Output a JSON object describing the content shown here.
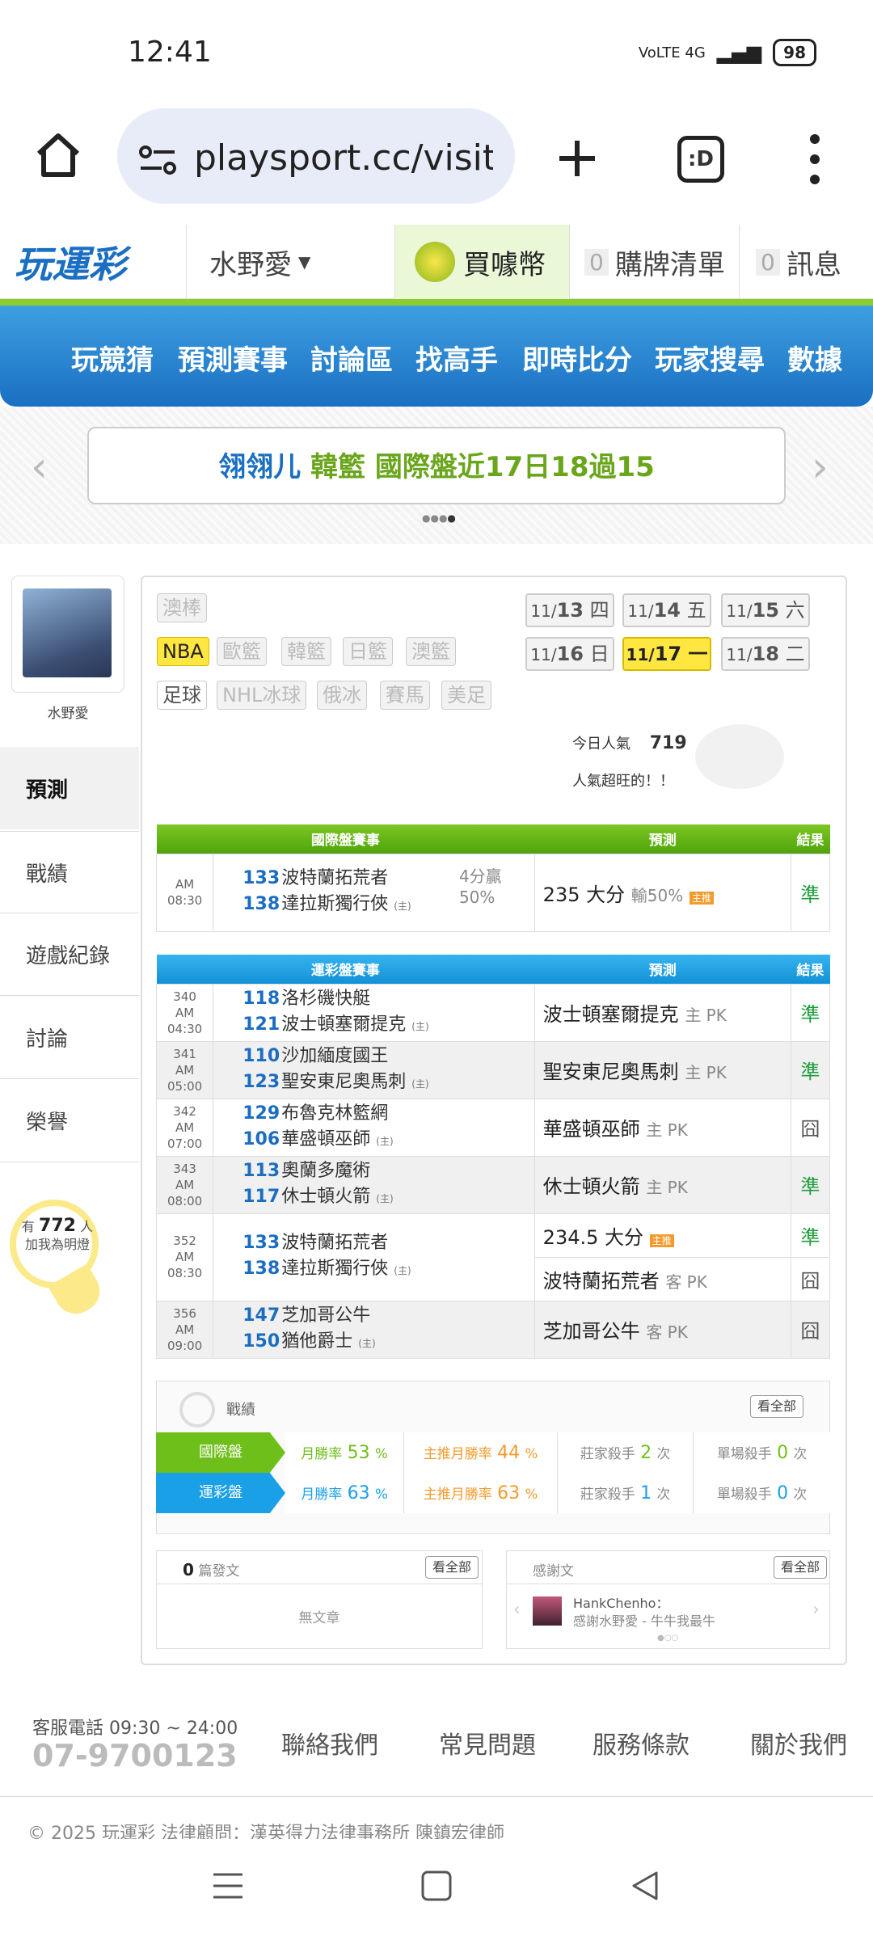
{
  "status_bar": {
    "time": "12:41",
    "network": "VoLTE 4G",
    "battery": "98"
  },
  "browser": {
    "url": "playsport.cc/visit",
    "tab_icon": ":D"
  },
  "site_header": {
    "logo": "玩運彩",
    "username": "水野愛",
    "buy_coins": "買噱幣",
    "buy_count": "0",
    "buy_list": "購牌清單",
    "msg_count": "0",
    "messages": "訊息"
  },
  "nav": {
    "items": [
      "玩競猜",
      "預測賽事",
      "討論區",
      "找高手",
      "即時比分",
      "玩家搜尋",
      "數據"
    ]
  },
  "banner": {
    "name": "翎翎儿",
    "text": "韓籃 國際盤近17日18過15"
  },
  "profile": {
    "name": "水野愛"
  },
  "side_tabs": [
    "預測",
    "戰績",
    "遊戲紀錄",
    "討論",
    "榮譽"
  ],
  "lamp": {
    "prefix": "有",
    "count": "772",
    "suffix": "人",
    "line2": "加我為明燈"
  },
  "sports": {
    "row1": [
      "澳棒"
    ],
    "row2": [
      "NBA",
      "歐籃",
      "韓籃",
      "日籃",
      "澳籃"
    ],
    "row3": [
      "足球",
      "NHL冰球",
      "俄冰",
      "賽馬",
      "美足"
    ]
  },
  "dates": [
    {
      "md": "11/",
      "d": "13",
      "w": "四"
    },
    {
      "md": "11/",
      "d": "14",
      "w": "五"
    },
    {
      "md": "11/",
      "d": "15",
      "w": "六"
    },
    {
      "md": "11/",
      "d": "16",
      "w": "日"
    },
    {
      "md": "11/",
      "d": "17",
      "w": "一"
    },
    {
      "md": "11/",
      "d": "18",
      "w": "二"
    }
  ],
  "popularity": {
    "label": "今日人氣",
    "value": "719",
    "note": "人氣超旺的！！"
  },
  "intl_table": {
    "headers": [
      "國際盤賽事",
      "預測",
      "結果"
    ],
    "rows": [
      {
        "time": "AM 08:30",
        "t1_no": "133",
        "t1": "波特蘭拓荒者",
        "t2_no": "138",
        "t2": "達拉斯獨行俠",
        "host": "(主)",
        "spread": "4分贏",
        "pct": "50%",
        "pred": "235 大分",
        "pred_note": "輸50%",
        "badge": "主推",
        "result": "準"
      }
    ]
  },
  "lottery_table": {
    "headers": [
      "運彩盤賽事",
      "預測",
      "結果"
    ],
    "rows": [
      {
        "num": "340",
        "time": "AM 04:30",
        "t1_no": "118",
        "t1": "洛杉磯快艇",
        "t2_no": "121",
        "t2": "波士頓塞爾提克",
        "pred": "波士頓塞爾提克",
        "pred_note": "主 PK",
        "result": "準"
      },
      {
        "num": "341",
        "time": "AM 05:00",
        "t1_no": "110",
        "t1": "沙加緬度國王",
        "t2_no": "123",
        "t2": "聖安東尼奧馬刺",
        "pred": "聖安東尼奧馬刺",
        "pred_note": "主 PK",
        "result": "準"
      },
      {
        "num": "342",
        "time": "AM 07:00",
        "t1_no": "129",
        "t1": "布魯克林籃網",
        "t2_no": "106",
        "t2": "華盛頓巫師",
        "pred": "華盛頓巫師",
        "pred_note": "主 PK",
        "result": "囧"
      },
      {
        "num": "343",
        "time": "AM 08:00",
        "t1_no": "113",
        "t1": "奧蘭多魔術",
        "t2_no": "117",
        "t2": "休士頓火箭",
        "pred": "休士頓火箭",
        "pred_note": "主 PK",
        "result": "準"
      },
      {
        "num": "352",
        "time": "AM 08:30",
        "t1_no": "133",
        "t1": "波特蘭拓荒者",
        "t2_no": "138",
        "t2": "達拉斯獨行俠",
        "pred": "234.5 大分",
        "pred_note": "",
        "badge": "主推",
        "result": "準",
        "pred2": "波特蘭拓荒者",
        "pred2_note": "客 PK",
        "result2": "囧"
      },
      {
        "num": "356",
        "time": "AM 09:00",
        "t1_no": "147",
        "t1": "芝加哥公牛",
        "t2_no": "150",
        "t2": "猶他爵士",
        "pred": "芝加哥公牛",
        "pred_note": "客 PK",
        "result": "囧"
      }
    ],
    "host": "(主)"
  },
  "record": {
    "title": "戰績",
    "view_all": "看全部",
    "rows": [
      {
        "label": "國際盤",
        "m_label": "月勝率",
        "m_val": "53",
        "p_label": "主推月勝率",
        "p_val": "44",
        "unit": "%",
        "z_label": "莊家殺手",
        "z_val": "2",
        "s_label": "單場殺手",
        "s_val": "0",
        "cnt": "次"
      },
      {
        "label": "運彩盤",
        "m_label": "月勝率",
        "m_val": "63",
        "p_label": "主推月勝率",
        "p_val": "63",
        "unit": "%",
        "z_label": "莊家殺手",
        "z_val": "1",
        "s_label": "單場殺手",
        "s_val": "0",
        "cnt": "次"
      }
    ],
    "colors": {
      "intl": "#6fbf1a",
      "lottery": "#1aa0e6"
    }
  },
  "posts": {
    "count": "0",
    "label": "篇發文",
    "view_all": "看全部",
    "empty": "無文章"
  },
  "thanks": {
    "label": "感謝文",
    "view_all": "看全部",
    "user": "HankChenho：",
    "text": "感謝水野愛 - 牛牛我最牛"
  },
  "footer": {
    "service": "客服電話 09:30 ~ 24:00",
    "phone": "07-9700123",
    "links": [
      "聯絡我們",
      "常見問題",
      "服務條款",
      "關於我們"
    ],
    "copyright": "© 2025 玩運彩 法律顧問：漢英得力法律事務所 陳鎮宏律師"
  }
}
